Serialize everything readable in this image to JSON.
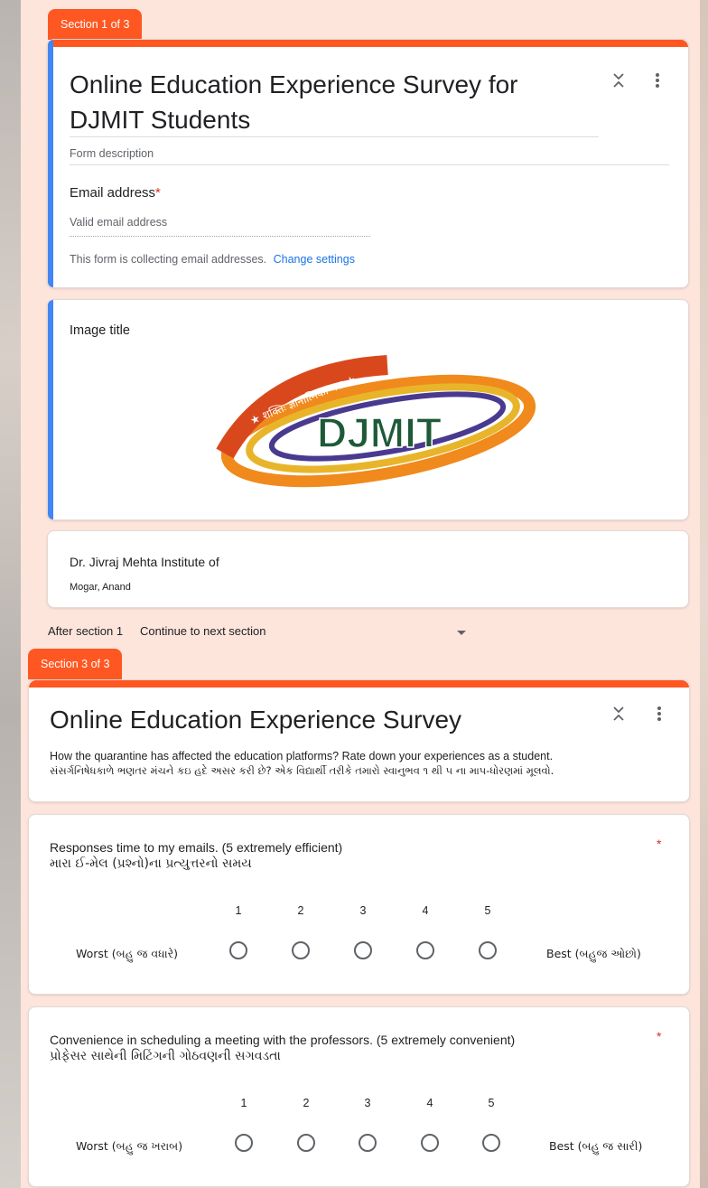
{
  "section1": {
    "tab": "Section 1 of 3",
    "title_line1": "Online Education Experience Survey for",
    "title_line2": "DJMIT Students",
    "description_placeholder": "Form description",
    "email_label": "Email address",
    "required_mark": "*",
    "email_placeholder": "Valid email address",
    "collecting_note": "This form is collecting email addresses.",
    "change_settings": "Change settings"
  },
  "image_block": {
    "title": "Image title",
    "logo": {
      "text": "DJMIT",
      "motto": "★ शक्तिः ज्ञानात्मिका परा ★"
    }
  },
  "text_block": {
    "title": "Dr. Jivraj Mehta Institute of",
    "subtitle": "Mogar, Anand"
  },
  "after_section": {
    "label": "After section 1",
    "value": "Continue to next section"
  },
  "section3": {
    "tab": "Section 3 of 3",
    "title": "Online Education Experience Survey",
    "desc_en": "How the quarantine has affected the education platforms? Rate down your experiences as a student.",
    "desc_gu": "સંસર્ગનિષેધકાળે ભણતર મંચને કઇ હદે અસર કરી છે? એક વિદ્યાર્થી તરીકે તમારો સ્વાનુભવ ૧ થી ૫ ના માપ-ધોરણમાં મૂલવો."
  },
  "questions": [
    {
      "title_en": "Responses time to my emails. (5 extremely efficient)",
      "title_gu": "મારા ઈ-મેલ (પ્રશ્નો)ના પ્રત્યુત્તરનો સમય",
      "required": "*",
      "scale": [
        "1",
        "2",
        "3",
        "4",
        "5"
      ],
      "low_label": "Worst (બહુ જ વધારે)",
      "high_label": "Best (બહુજ ઓછો)"
    },
    {
      "title_en": "Convenience in scheduling a meeting with the professors. (5 extremely convenient)",
      "title_gu": "પ્રોફેસર સાથેની મિટિંગની ગોઠવણની સગવડતા",
      "required": "*",
      "scale": [
        "1",
        "2",
        "3",
        "4",
        "5"
      ],
      "low_label": "Worst (બહુ જ ખરાબ)",
      "high_label": "Best (બહુ જ સારી)"
    }
  ],
  "icons": {
    "collapse": "collapse-icon",
    "more": "more-vert-icon",
    "dropdown": "arrow-drop-down-icon"
  },
  "colors": {
    "accent": "#ff5722",
    "canvas": "#fde5dc",
    "link": "#1a73e8",
    "selected_border": "#4285f4",
    "required": "#d93025"
  }
}
